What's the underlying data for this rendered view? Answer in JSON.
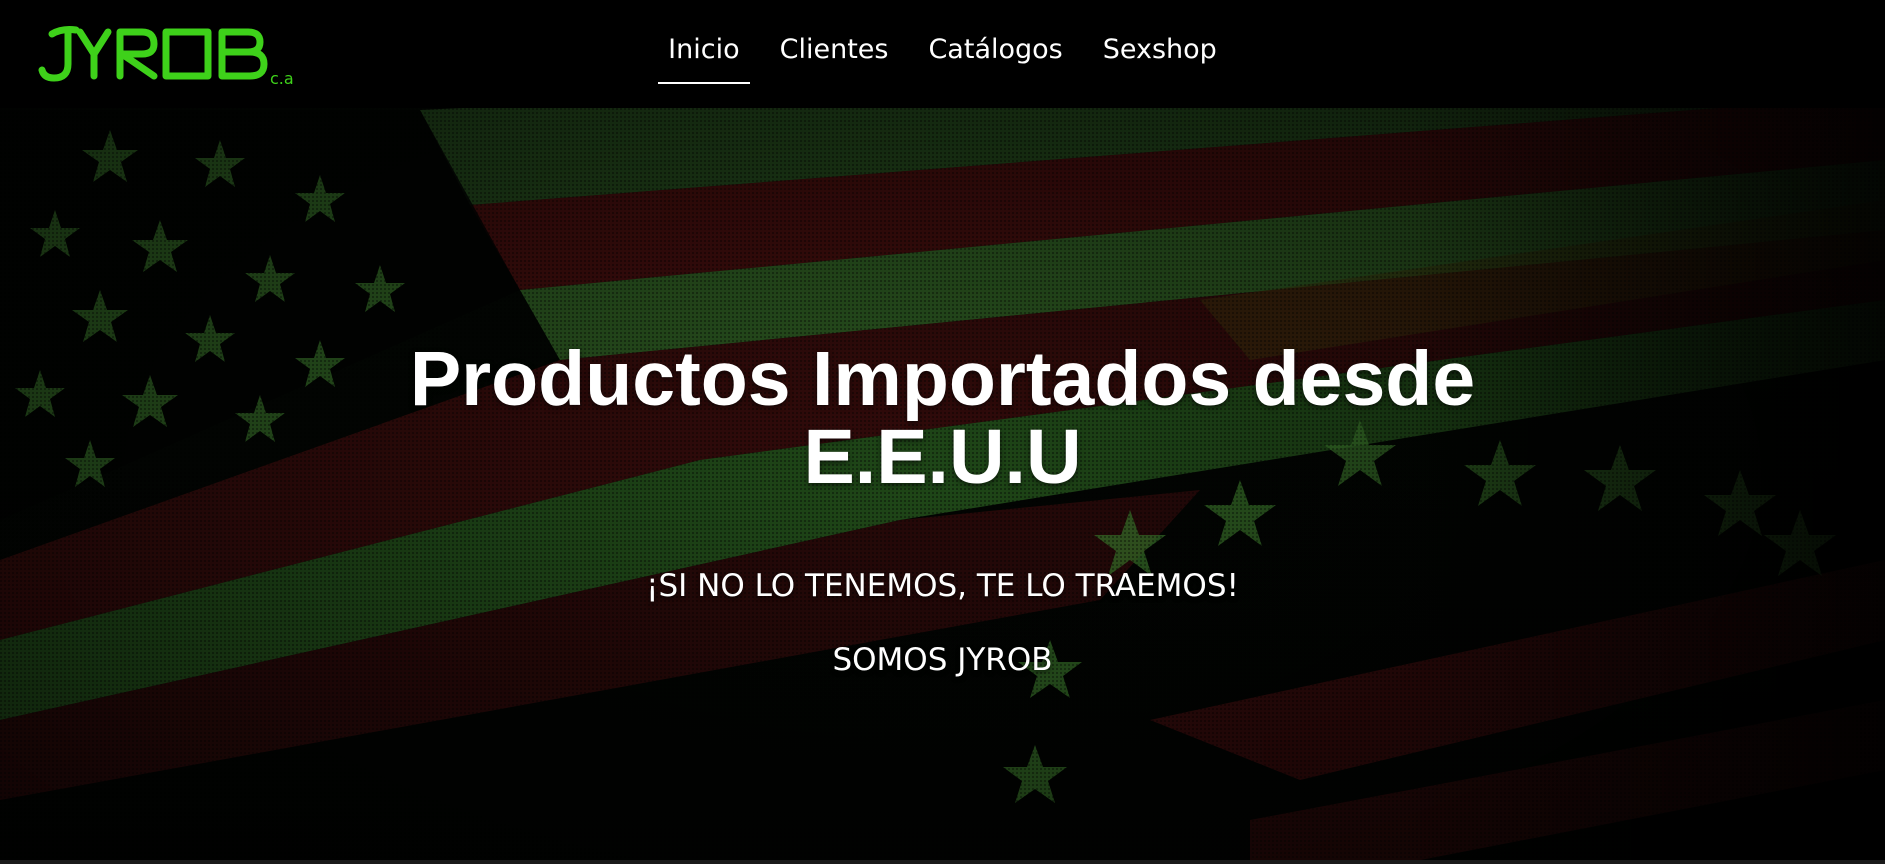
{
  "brand": {
    "logo_text": "JYROB",
    "logo_suffix": "c.a",
    "logo_color": "#3ed11a"
  },
  "nav": {
    "items": [
      {
        "label": "Inicio",
        "active": true
      },
      {
        "label": "Clientes",
        "active": false
      },
      {
        "label": "Catálogos",
        "active": false
      },
      {
        "label": "Sexshop",
        "active": false
      }
    ]
  },
  "hero": {
    "title_line1": "Productos Importados desde",
    "title_line2": "E.E.U.U",
    "tagline": "¡SI NO LO TENEMOS, TE LO TRAEMOS!",
    "subtagline": "SOMOS JYROB",
    "background_icon": "american-flag-green-tinted",
    "colors": {
      "stripe_green": "#3d7a2e",
      "stripe_red": "#6b1414",
      "star_green": "#4fa03a"
    }
  }
}
